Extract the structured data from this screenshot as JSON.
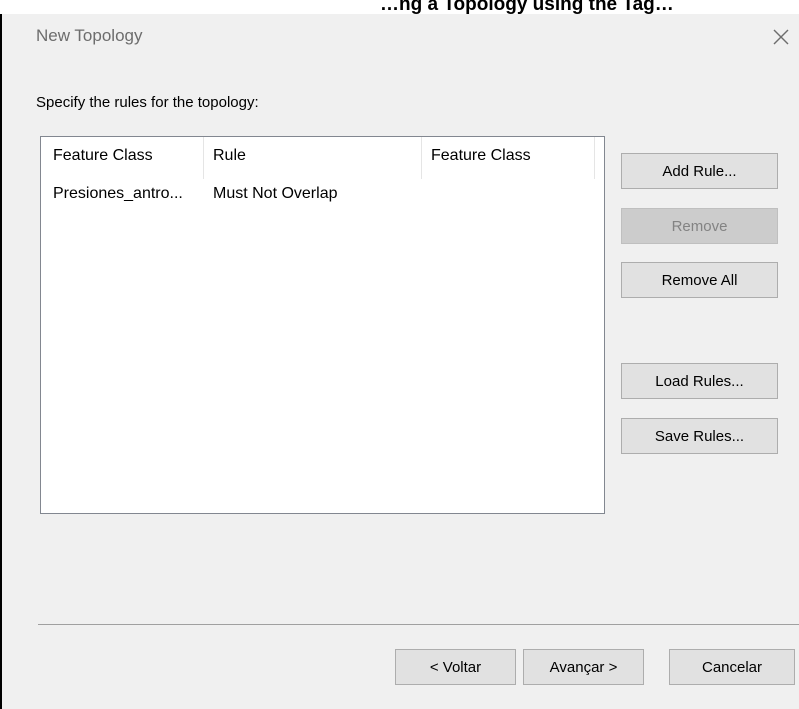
{
  "overlay": {
    "cut_caption": "…ng a Topology using the Tag…"
  },
  "window": {
    "title": "New Topology",
    "close_glyph": "×"
  },
  "instruction": "Specify the rules for the topology:",
  "table": {
    "columns": [
      "Feature Class",
      "Rule",
      "Feature Class"
    ],
    "rows": [
      {
        "feature_class": "Presiones_antro...",
        "rule": "Must Not Overlap",
        "feature_class_2": ""
      }
    ]
  },
  "buttons": {
    "add_rule": "Add Rule...",
    "remove": "Remove",
    "remove_all": "Remove All",
    "load_rules": "Load Rules...",
    "save_rules": "Save Rules..."
  },
  "nav": {
    "back": "< Voltar",
    "next": "Avançar >",
    "cancel": "Cancelar"
  },
  "state": {
    "remove_enabled": false
  }
}
